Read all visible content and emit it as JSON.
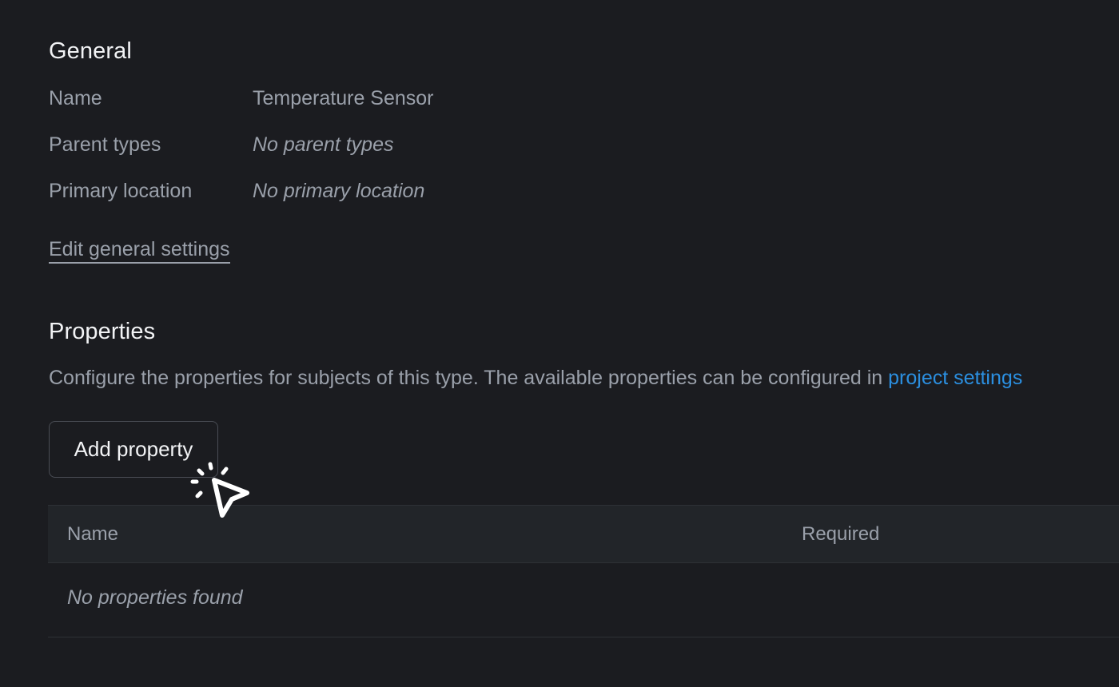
{
  "general": {
    "title": "General",
    "fields": [
      {
        "label": "Name",
        "value": "Temperature Sensor"
      },
      {
        "label": "Parent types",
        "value": "No parent types"
      },
      {
        "label": "Primary location",
        "value": "No primary location"
      }
    ],
    "edit_link": "Edit general settings"
  },
  "properties": {
    "title": "Properties",
    "description": "Configure the properties for subjects of this type. The available properties can be configured in ",
    "description_link": "project settings",
    "add_button": "Add property",
    "table": {
      "columns": [
        "Name",
        "Required"
      ],
      "empty_text": "No properties found"
    }
  },
  "colors": {
    "background": "#1b1c20",
    "heading": "#f2f3f5",
    "muted_text": "#9aa0aa",
    "link": "#2b8fe0",
    "table_header_bg": "#222529"
  },
  "icons": {
    "cursor": "click-pointer-icon"
  }
}
